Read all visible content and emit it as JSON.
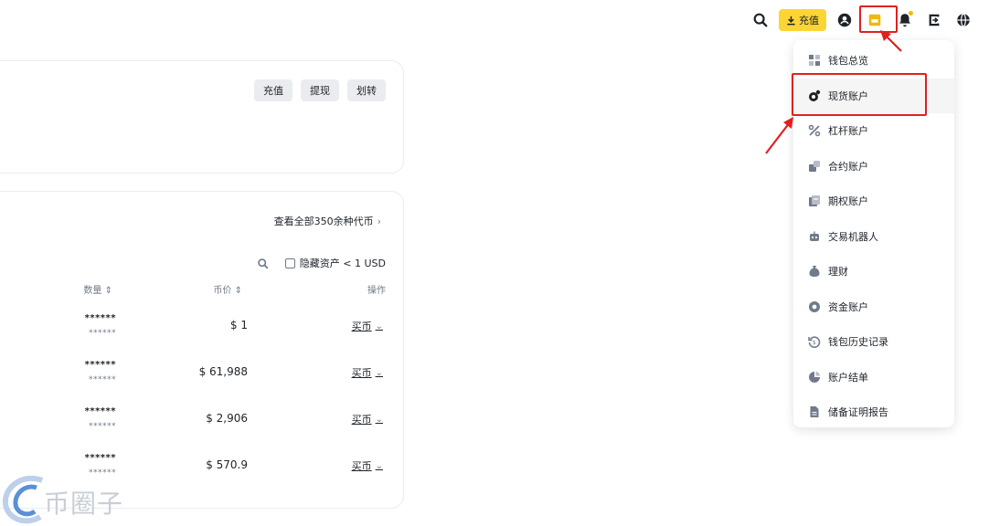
{
  "topbar": {
    "deposit_label": "充值",
    "icons": [
      "search-icon",
      "download-icon",
      "user-icon",
      "wallet-icon",
      "bell-icon",
      "download-app-icon",
      "globe-icon"
    ],
    "accent_color": "#fcd535"
  },
  "overview_card": {
    "buttons": [
      "充值",
      "提现",
      "划转"
    ]
  },
  "assets_card": {
    "view_all": "查看全部350余种代币",
    "hide_small": "隐藏资产 < 1 USD",
    "columns": {
      "qty": "数量",
      "price": "币价",
      "op": "操作"
    },
    "rows": [
      {
        "qty": "******",
        "qty_sub": "******",
        "price": "$ 1",
        "action": "买币"
      },
      {
        "qty": "******",
        "qty_sub": "******",
        "price": "$ 61,988",
        "action": "买币"
      },
      {
        "qty": "******",
        "qty_sub": "******",
        "price": "$ 2,906",
        "action": "买币"
      },
      {
        "qty": "******",
        "qty_sub": "******",
        "price": "$ 570.9",
        "action": "买币"
      }
    ]
  },
  "wallet_menu": {
    "items": [
      {
        "label": "钱包总览",
        "icon": "grid-icon"
      },
      {
        "label": "现货账户",
        "icon": "spot-icon",
        "active": true
      },
      {
        "label": "杠杆账户",
        "icon": "margin-icon"
      },
      {
        "label": "合约账户",
        "icon": "futures-icon"
      },
      {
        "label": "期权账户",
        "icon": "options-icon"
      },
      {
        "label": "交易机器人",
        "icon": "robot-icon"
      },
      {
        "label": "理财",
        "icon": "earn-icon"
      },
      {
        "label": "资金账户",
        "icon": "funding-icon"
      },
      {
        "label": "钱包历史记录",
        "icon": "history-icon"
      },
      {
        "label": "账户结单",
        "icon": "statement-icon"
      },
      {
        "label": "储备证明报告",
        "icon": "report-icon"
      }
    ]
  },
  "watermark": {
    "text": "币圈子"
  },
  "highlight_color": "#e02020"
}
